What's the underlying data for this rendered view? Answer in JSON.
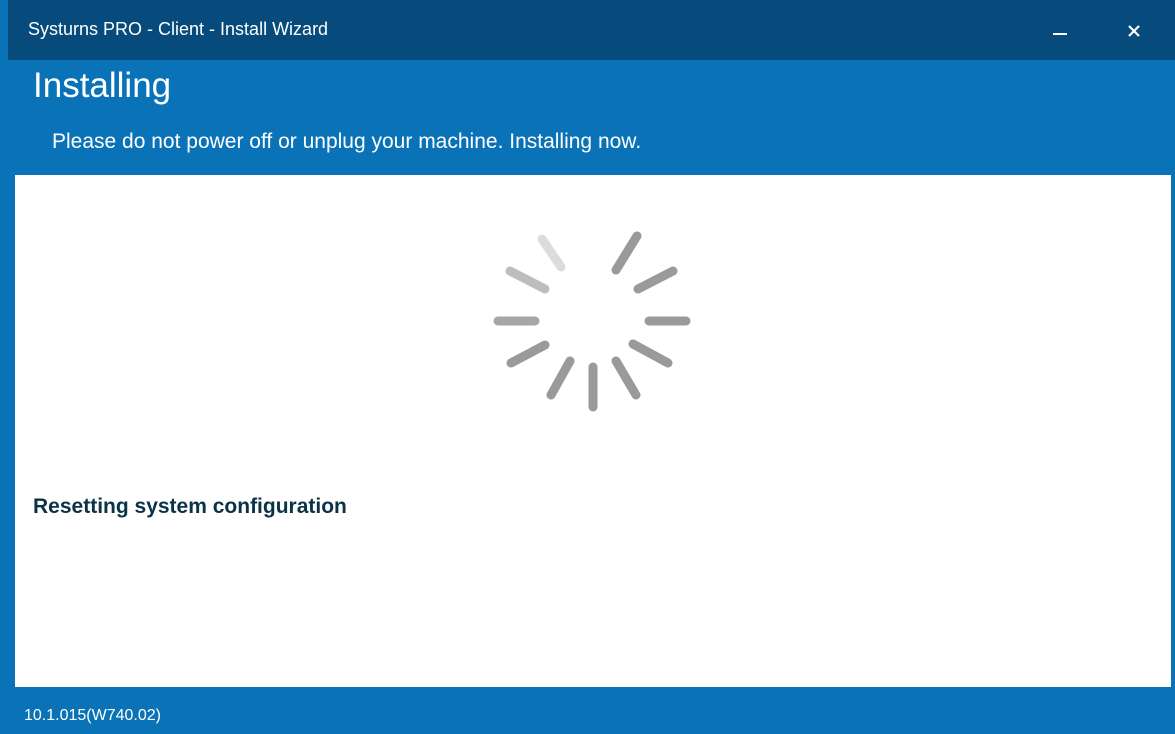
{
  "window": {
    "title": "Systurns PRO - Client  -  Install Wizard",
    "minimize_icon": "minimize-icon",
    "close_icon": "close-icon"
  },
  "header": {
    "title": "Installing",
    "subtitle": "Please do not power off or unplug your machine. Installing now."
  },
  "main": {
    "spinner_icon": "loading-spinner-icon",
    "status": "Resetting system configuration"
  },
  "footer": {
    "version": "10.1.015(W740.02)"
  },
  "colors": {
    "titlebar": "#074b7c",
    "accent": "#0a73b7",
    "status_text": "#0b3247",
    "spinner": "#9a9a9a"
  }
}
